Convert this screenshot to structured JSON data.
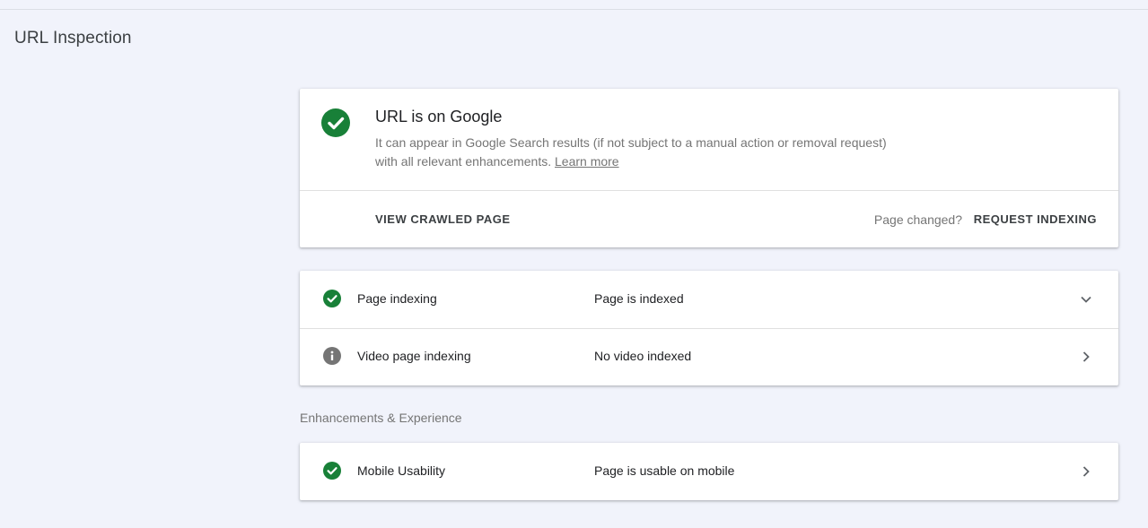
{
  "page": {
    "title": "URL Inspection"
  },
  "summary": {
    "title": "URL is on Google",
    "description": "It can appear in Google Search results (if not subject to a manual action or removal request) with all relevant enhancements.",
    "learn_more": "Learn more",
    "view_crawled_label": "VIEW CRAWLED PAGE",
    "page_changed": "Page changed?",
    "request_indexing_label": "REQUEST INDEXING",
    "status_icon": "check-circle-icon"
  },
  "status_rows": [
    {
      "label": "Page indexing",
      "value": "Page is indexed",
      "icon": "check-circle-icon",
      "chevron": "chevron-down-icon"
    },
    {
      "label": "Video page indexing",
      "value": "No video indexed",
      "icon": "info-icon",
      "chevron": "chevron-right-icon"
    }
  ],
  "enhancements": {
    "section_label": "Enhancements & Experience",
    "rows": [
      {
        "label": "Mobile Usability",
        "value": "Page is usable on mobile",
        "icon": "check-circle-icon",
        "chevron": "chevron-right-icon"
      }
    ]
  },
  "colors": {
    "success": "#188038",
    "info": "#757575",
    "background": "#f1f3fb"
  }
}
